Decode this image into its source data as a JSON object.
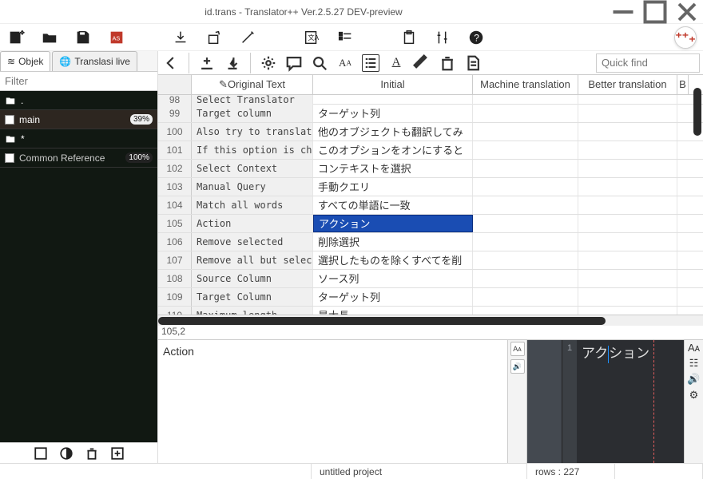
{
  "title": "id.trans - Translator++ Ver.2.5.27 DEV-preview",
  "tabs": {
    "object": "Objek",
    "live": "Translasi live"
  },
  "filter_placeholder": "Filter",
  "tree": [
    {
      "name": ".",
      "type": "folder"
    },
    {
      "name": "main",
      "type": "check",
      "badge": "39%",
      "selected": true
    },
    {
      "name": "*",
      "type": "folder"
    },
    {
      "name": "Common Reference",
      "type": "check",
      "badge": "100%"
    }
  ],
  "quick_placeholder": "Quick find",
  "columns": {
    "orig": "Original Text",
    "init": "Initial",
    "mt": "Machine translation",
    "bt": "Better translation"
  },
  "rows": [
    {
      "n": 98,
      "orig": "Select Translator",
      "init": "",
      "cut": true
    },
    {
      "n": 99,
      "orig": "Target column",
      "init": "ターゲット列"
    },
    {
      "n": 100,
      "orig": "Also try to translat",
      "init": "他のオブジェクトも翻訳してみ"
    },
    {
      "n": 101,
      "orig": "If this option is ch",
      "init": "このオプションをオンにすると"
    },
    {
      "n": 102,
      "orig": "Select Context",
      "init": "コンテキストを選択"
    },
    {
      "n": 103,
      "orig": "Manual Query",
      "init": "手動クエリ"
    },
    {
      "n": 104,
      "orig": "Match all words",
      "init": "すべての単語に一致"
    },
    {
      "n": 105,
      "orig": "Action",
      "init": "アクション",
      "sel": true
    },
    {
      "n": 106,
      "orig": "Remove selected",
      "init": "削除選択"
    },
    {
      "n": 107,
      "orig": "Remove all but selec",
      "init": "選択したものを除くすべてを削"
    },
    {
      "n": 108,
      "orig": "Source Column",
      "init": "ソース列"
    },
    {
      "n": 109,
      "orig": "Target Column",
      "init": "ターゲット列"
    },
    {
      "n": 110,
      "orig": "Maximum length",
      "init": "最大長"
    }
  ],
  "coord": "105,2",
  "lower_left": "Action",
  "editor_line": "1",
  "editor_text": "アクション",
  "status": {
    "project": "untitled project",
    "rows": "rows : 227"
  }
}
